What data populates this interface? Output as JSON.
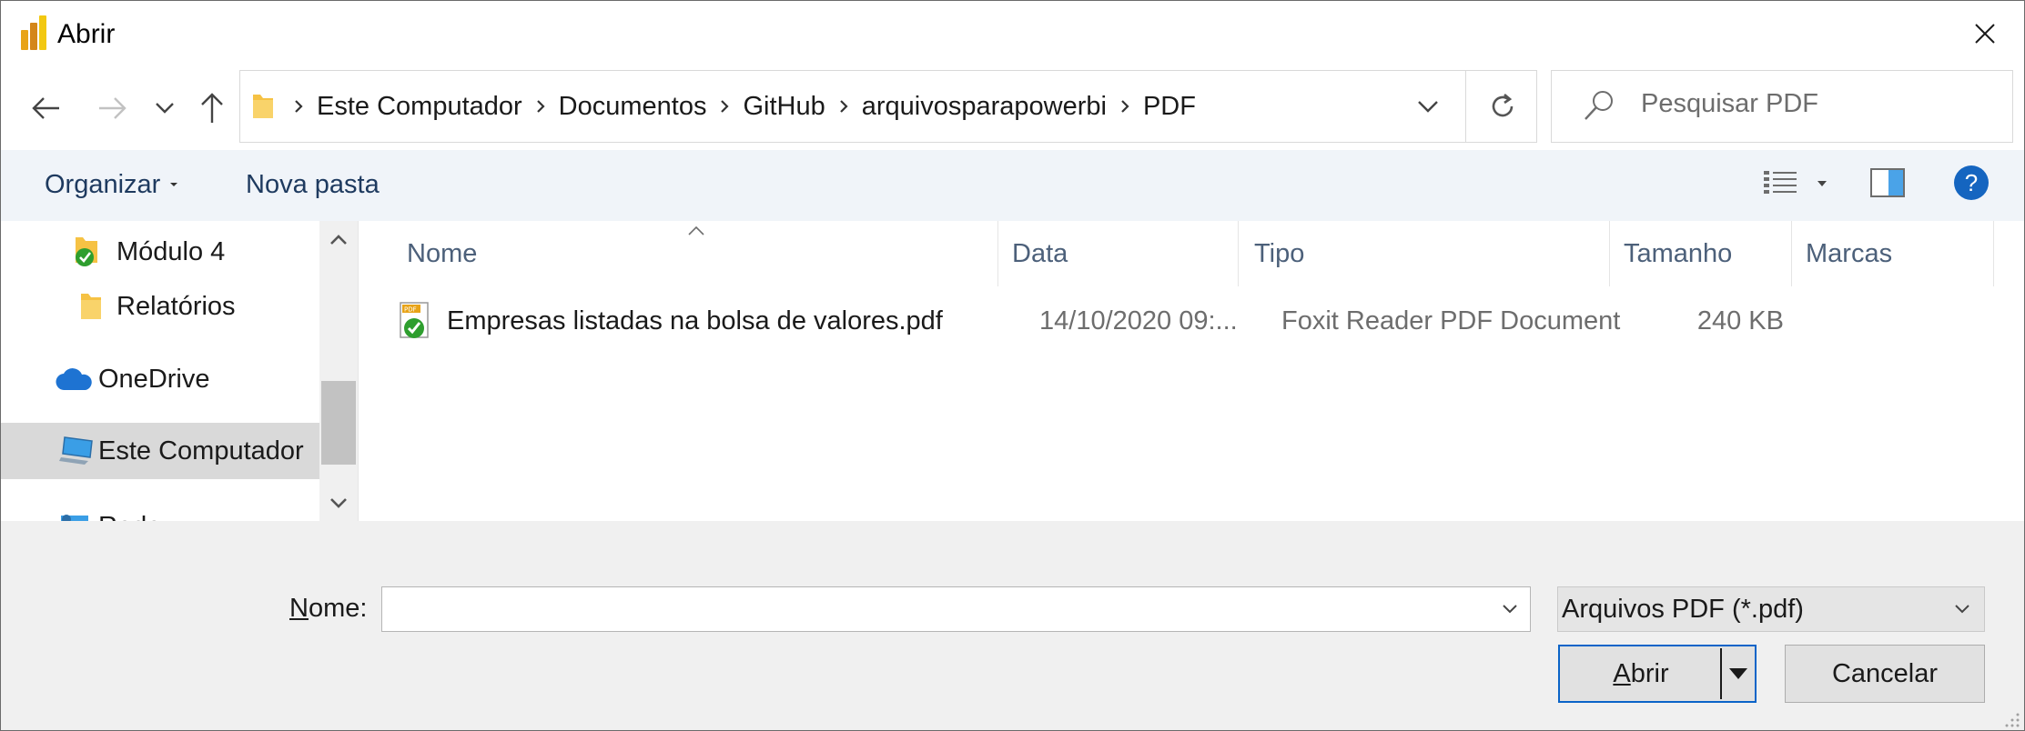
{
  "window": {
    "title": "Abrir"
  },
  "navigation": {
    "back_icon": "arrow-left-icon",
    "forward_icon": "arrow-right-icon",
    "recent_icon": "chevron-down-icon",
    "up_icon": "arrow-up-icon"
  },
  "address": {
    "crumbs": [
      "Este Computador",
      "Documentos",
      "GitHub",
      "arquivosparapowerbi",
      "PDF"
    ]
  },
  "search": {
    "placeholder": "Pesquisar PDF"
  },
  "toolbar": {
    "organize_label": "Organizar",
    "new_folder_label": "Nova pasta",
    "help_label": "?"
  },
  "nav_pane": {
    "items": [
      {
        "label": "Módulo 4",
        "icon": "folder-synced-icon"
      },
      {
        "label": "Relatórios",
        "icon": "folder-icon"
      },
      {
        "label": "OneDrive",
        "icon": "cloud-icon"
      },
      {
        "label": "Este Computador",
        "icon": "computer-icon",
        "selected": true
      },
      {
        "label": "Rede",
        "icon": "network-icon"
      }
    ]
  },
  "file_list": {
    "columns": [
      "Nome",
      "Data",
      "Tipo",
      "Tamanho",
      "Marcas"
    ],
    "rows": [
      {
        "name": "Empresas listadas na bolsa de valores.pdf",
        "date": "14/10/2020 09:...",
        "type": "Foxit Reader PDF Document",
        "size": "240 KB",
        "tags": ""
      }
    ]
  },
  "footer": {
    "name_label_underlined": "N",
    "name_label_rest": "ome:",
    "name_value": "",
    "filetype_selected": "Arquivos PDF (*.pdf)",
    "open_label_underlined": "A",
    "open_label_rest": "brir",
    "cancel_label": "Cancelar"
  },
  "colors": {
    "accent": "#0a64c8",
    "command_bar": "#f0f4f9",
    "footer_bg": "#f0f0f0",
    "header_text": "#4c607a"
  }
}
